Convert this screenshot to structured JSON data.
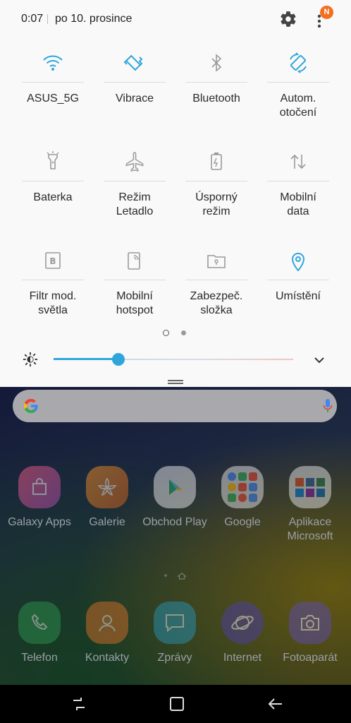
{
  "status": {
    "time": "0:07",
    "date": "po 10. prosince",
    "notification_badge": "N",
    "badge_color": "#f26f21"
  },
  "tiles": [
    {
      "label": "ASUS_5G",
      "icon": "wifi-icon",
      "active": true
    },
    {
      "label": "Vibrace",
      "icon": "vibrate-icon",
      "active": true
    },
    {
      "label": "Bluetooth",
      "icon": "bluetooth-icon",
      "active": false
    },
    {
      "label": "Autom.\notočení",
      "icon": "auto-rotate-icon",
      "active": true
    },
    {
      "label": "Baterka",
      "icon": "flashlight-icon",
      "active": false
    },
    {
      "label": "Režim\nLetadlo",
      "icon": "airplane-icon",
      "active": false
    },
    {
      "label": "Úsporný\nrežim",
      "icon": "power-saving-icon",
      "active": false
    },
    {
      "label": "Mobilní\ndata",
      "icon": "mobile-data-icon",
      "active": false
    },
    {
      "label": "Filtr mod.\nsvětla",
      "icon": "blue-light-filter-icon",
      "active": false
    },
    {
      "label": "Mobilní\nhotspot",
      "icon": "hotspot-icon",
      "active": false
    },
    {
      "label": "Zabezpeč.\nsložka",
      "icon": "secure-folder-icon",
      "active": false
    },
    {
      "label": "Umístění",
      "icon": "location-icon",
      "active": true
    }
  ],
  "brightness": {
    "level": 0.27,
    "accent": "#2fa6db"
  },
  "colors": {
    "active": "#2fa6db",
    "inactive": "#9a9a9a"
  },
  "apps_row1": [
    {
      "label": "Galaxy Apps",
      "icon": "galaxy-apps-icon"
    },
    {
      "label": "Galerie",
      "icon": "gallery-icon"
    },
    {
      "label": "Obchod Play",
      "icon": "play-store-icon"
    },
    {
      "label": "Google",
      "icon": "google-folder-icon"
    },
    {
      "label": "Aplikace\nMicrosoft",
      "icon": "microsoft-folder-icon"
    }
  ],
  "apps_dock": [
    {
      "label": "Telefon",
      "icon": "phone-icon"
    },
    {
      "label": "Kontakty",
      "icon": "contacts-icon"
    },
    {
      "label": "Zprávy",
      "icon": "messages-icon"
    },
    {
      "label": "Internet",
      "icon": "internet-icon"
    },
    {
      "label": "Fotoaparát",
      "icon": "camera-icon"
    }
  ]
}
